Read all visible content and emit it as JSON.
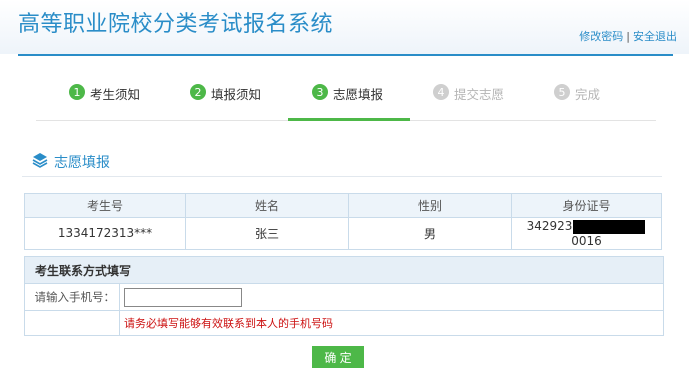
{
  "header": {
    "title": "高等职业院校分类考试报名系统",
    "links": {
      "change_password": "修改密码",
      "separator": "|",
      "logout": "安全退出"
    }
  },
  "steps": [
    {
      "num": "1",
      "label": "考生须知",
      "state": "done"
    },
    {
      "num": "2",
      "label": "填报须知",
      "state": "done"
    },
    {
      "num": "3",
      "label": "志愿填报",
      "state": "active"
    },
    {
      "num": "4",
      "label": "提交志愿",
      "state": "todo"
    },
    {
      "num": "5",
      "label": "完成",
      "state": "todo"
    }
  ],
  "section": {
    "title": "志愿填报",
    "icon": "layers-icon"
  },
  "info_table": {
    "headers": [
      "考生号",
      "姓名",
      "性别",
      "身份证号"
    ],
    "row": {
      "exam_no": "1334172313***",
      "name": "张三",
      "gender": "男",
      "id_prefix": "342923",
      "id_suffix": "0016"
    }
  },
  "contact_form": {
    "heading": "考生联系方式填写",
    "phone_label": "请输入手机号：",
    "phone_value": "",
    "phone_placeholder": "",
    "note": "请务必填写能够有效联系到本人的手机号码"
  },
  "submit_label": "确 定",
  "colors": {
    "accent_blue": "#2a8dc8",
    "step_green": "#4db848",
    "step_todo": "#cfcfcf",
    "note_red": "#cc1111"
  }
}
